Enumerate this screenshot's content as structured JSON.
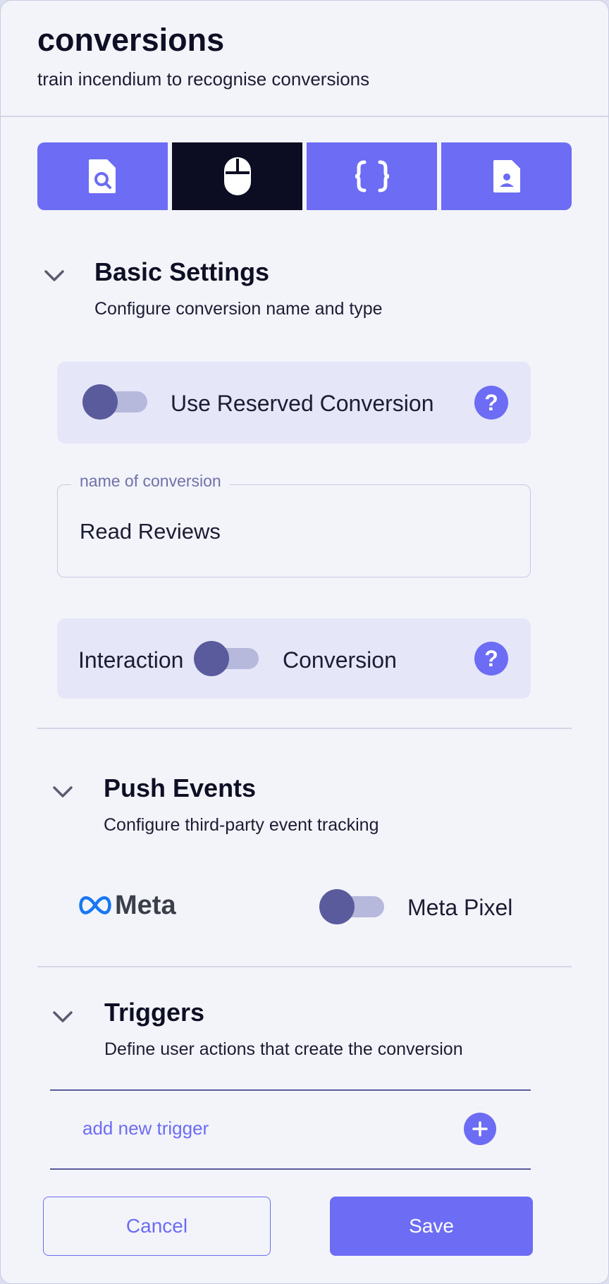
{
  "header": {
    "title": "conversions",
    "subtitle": "train incendium to recognise conversions"
  },
  "tabs": [
    {
      "icon": "file-search-icon",
      "active": false
    },
    {
      "icon": "mouse-icon",
      "active": true
    },
    {
      "icon": "code-braces-icon",
      "active": false
    },
    {
      "icon": "user-document-icon",
      "active": false
    }
  ],
  "basic_settings": {
    "title": "Basic Settings",
    "description": "Configure conversion name and type",
    "reserved_toggle_label": "Use Reserved Conversion",
    "reserved_toggle_on": false,
    "help_symbol": "?",
    "name_field": {
      "legend": "name of conversion",
      "value": "Read Reviews"
    },
    "type_toggle": {
      "left_label": "Interaction",
      "right_label": "Conversion",
      "on": false
    }
  },
  "push_events": {
    "title": "Push Events",
    "description": "Configure third-party event tracking",
    "provider_logo_text": "Meta",
    "toggle_label": "Meta Pixel",
    "toggle_on": false
  },
  "triggers": {
    "title": "Triggers",
    "description": "Define user actions that create the conversion",
    "add_label": "add new trigger"
  },
  "footer": {
    "cancel_label": "Cancel",
    "save_label": "Save"
  },
  "colors": {
    "accent": "#6c6cf4",
    "active_tab": "#0c0c22",
    "toggle_knob": "#5a5b9c",
    "card_bg": "#e5e6f8"
  }
}
